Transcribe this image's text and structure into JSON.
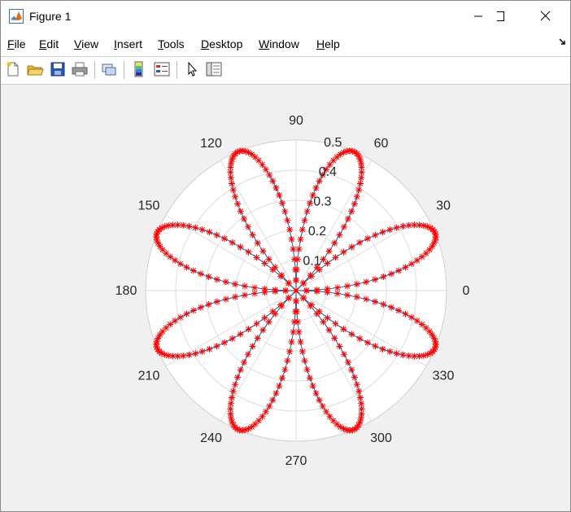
{
  "window": {
    "title": "Figure 1",
    "controls": {
      "minimize": "minimize",
      "maximize": "maximize",
      "close": "close"
    }
  },
  "menu": [
    "File",
    "Edit",
    "View",
    "Insert",
    "Tools",
    "Desktop",
    "Window",
    "Help"
  ],
  "toolbar": {
    "buttons": [
      "new-figure-icon",
      "open-file-icon",
      "save-icon",
      "print-icon",
      "link-plot-icon",
      "insert-colorbar-icon",
      "insert-legend-icon",
      "edit-plot-arrow-icon",
      "property-inspector-icon"
    ]
  },
  "chart_data": {
    "type": "polar",
    "series": [
      {
        "function": "r = 0.5 * |sin(4*theta)|",
        "theta_range_deg": [
          0,
          360
        ],
        "line_color": "#0072bd",
        "marker": "star",
        "marker_color": "#ff0000",
        "petals": 8
      }
    ],
    "theta_tick_labels": [
      "0",
      "30",
      "60",
      "90",
      "120",
      "150",
      "180",
      "210",
      "240",
      "270",
      "300",
      "330"
    ],
    "r_tick_labels": [
      "0.1",
      "0.2",
      "0.3",
      "0.4",
      "0.5"
    ],
    "rlim": [
      0,
      0.5
    ],
    "grid": true
  }
}
